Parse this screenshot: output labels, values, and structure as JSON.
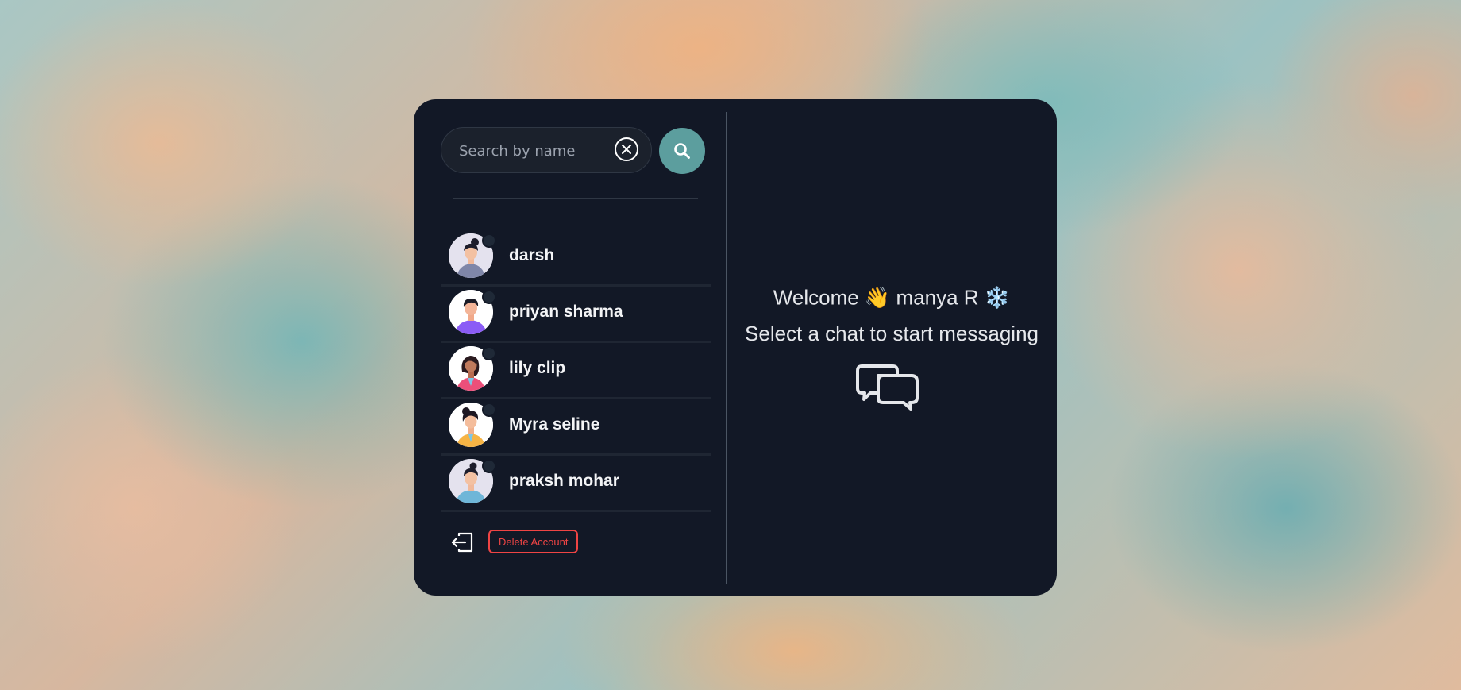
{
  "search": {
    "placeholder": "Search by name",
    "value": "",
    "clear_icon": "close-circle-icon",
    "submit_icon": "search-icon"
  },
  "conversations": [
    {
      "name": "darsh",
      "avatar": "avatar-male-bun",
      "status": "offline"
    },
    {
      "name": "priyan sharma",
      "avatar": "avatar-male-purple-shirt",
      "status": "offline"
    },
    {
      "name": "lily clip",
      "avatar": "avatar-female-pink",
      "status": "offline"
    },
    {
      "name": "Myra seline",
      "avatar": "avatar-female-yellow",
      "status": "offline"
    },
    {
      "name": "praksh mohar",
      "avatar": "avatar-male-blue-shirt",
      "status": "offline"
    }
  ],
  "footer": {
    "logout_icon": "logout-icon",
    "delete_label": "Delete Account"
  },
  "welcome": {
    "greeting": "Welcome",
    "wave_emoji": "👋",
    "username": "manya R",
    "snow_emoji": "❄️",
    "prompt": "Select a chat to start messaging",
    "chat_icon": "chat-bubbles-icon"
  },
  "colors": {
    "card_bg": "#121826",
    "search_button": "#5c9e9e",
    "danger": "#ef4444",
    "text": "#e5e7eb"
  }
}
